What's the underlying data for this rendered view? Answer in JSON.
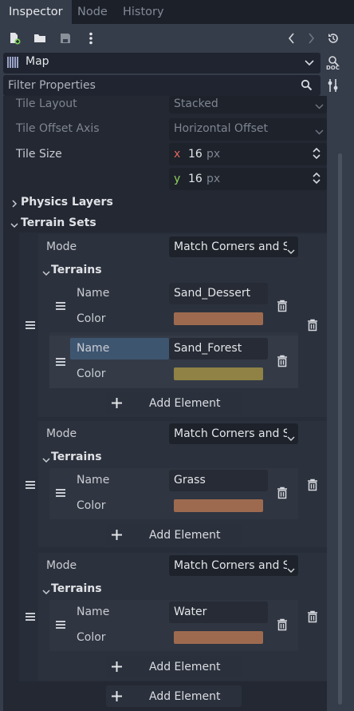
{
  "tabs": [
    {
      "label": "Inspector",
      "active": true
    },
    {
      "label": "Node",
      "active": false
    },
    {
      "label": "History",
      "active": false
    }
  ],
  "toolbar": {
    "icons": [
      "new-resource-icon",
      "open-folder-icon",
      "save-icon",
      "more-vertical-icon"
    ],
    "nav": [
      "chevron-left-icon",
      "chevron-right-icon",
      "history-icon"
    ]
  },
  "object": {
    "icon": "tilemap-icon",
    "name": "Map",
    "doc_label": "DOC"
  },
  "filter": {
    "placeholder": "Filter Properties"
  },
  "properties": {
    "tile_layout": {
      "label": "Tile Layout",
      "value": "Stacked"
    },
    "tile_offset_axis": {
      "label": "Tile Offset Axis",
      "value": "Horizontal Offset"
    },
    "tile_size": {
      "label": "Tile Size",
      "x_label": "x",
      "x": "16",
      "y_label": "y",
      "y": "16",
      "unit": "px"
    }
  },
  "sections": {
    "physics_layers": "Physics Layers",
    "terrain_sets": "Terrain Sets"
  },
  "terrain_sets": [
    {
      "mode_label": "Mode",
      "mode_value": "Match Corners and Sid",
      "terrains_label": "Terrains",
      "terrains": [
        {
          "name_label": "Name",
          "name": "Sand_Dessert",
          "color_label": "Color",
          "color": "#9e6a4f"
        },
        {
          "name_label": "Name",
          "name": "Sand_Forest",
          "color_label": "Color",
          "color": "#8f8244"
        }
      ],
      "add_label": "Add Element"
    },
    {
      "mode_label": "Mode",
      "mode_value": "Match Corners and Sid",
      "terrains_label": "Terrains",
      "terrains": [
        {
          "name_label": "Name",
          "name": "Grass",
          "color_label": "Color",
          "color": "#9e6a4f"
        }
      ],
      "add_label": "Add Element"
    },
    {
      "mode_label": "Mode",
      "mode_value": "Match Corners and Sid",
      "terrains_label": "Terrains",
      "terrains": [
        {
          "name_label": "Name",
          "name": "Water",
          "color_label": "Color",
          "color": "#9e6a4f"
        }
      ],
      "add_label": "Add Element"
    }
  ],
  "outer_add_label": "Add Element",
  "colors": {
    "axis_x": "#e0675b",
    "axis_y": "#8fd05a",
    "selected_row": "#3e5570"
  }
}
